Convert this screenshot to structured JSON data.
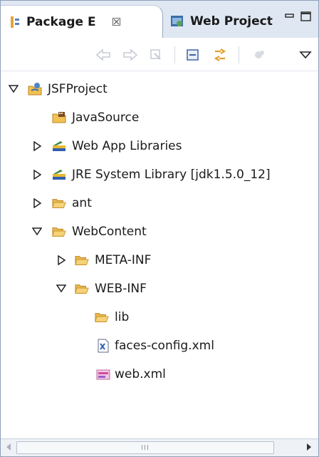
{
  "tabs": [
    {
      "label": "Package E",
      "icon": "package-explorer-icon",
      "active": true
    },
    {
      "label": "Web Project",
      "icon": "web-project-icon",
      "active": false
    }
  ],
  "tab_close_symbol": "☒",
  "toolbar": {
    "buttons": [
      "back-icon",
      "forward-icon",
      "go-into-icon",
      "collapse-all-icon",
      "link-with-editor-icon",
      "view-menu-icon"
    ]
  },
  "tree": {
    "items": [
      {
        "label": "JSFProject",
        "icon": "project-icon",
        "twisty": "expanded",
        "depth": 0
      },
      {
        "label": "JavaSource",
        "icon": "source-folder-icon",
        "twisty": "none",
        "depth": 1
      },
      {
        "label": "Web App Libraries",
        "icon": "library-icon",
        "twisty": "collapsed",
        "depth": 1
      },
      {
        "label": "JRE System Library [jdk1.5.0_12]",
        "icon": "library-icon",
        "twisty": "collapsed",
        "depth": 1
      },
      {
        "label": "ant",
        "icon": "folder-icon",
        "twisty": "collapsed",
        "depth": 1
      },
      {
        "label": "WebContent",
        "icon": "folder-icon",
        "twisty": "expanded",
        "depth": 1
      },
      {
        "label": "META-INF",
        "icon": "folder-icon",
        "twisty": "collapsed",
        "depth": 2
      },
      {
        "label": "WEB-INF",
        "icon": "folder-icon",
        "twisty": "expanded",
        "depth": 2
      },
      {
        "label": "lib",
        "icon": "folder-icon",
        "twisty": "none",
        "depth": 3
      },
      {
        "label": "faces-config.xml",
        "icon": "xml-file-icon",
        "twisty": "none",
        "depth": 3
      },
      {
        "label": "web.xml",
        "icon": "web-xml-icon",
        "twisty": "none",
        "depth": 3
      }
    ]
  },
  "scrollbar": {
    "thumb_grip": "III"
  },
  "colors": {
    "tab_strip": "#dfe7f2",
    "border": "#8f9fb8",
    "folder": "#f1c152",
    "library": "#2f5fb0"
  }
}
